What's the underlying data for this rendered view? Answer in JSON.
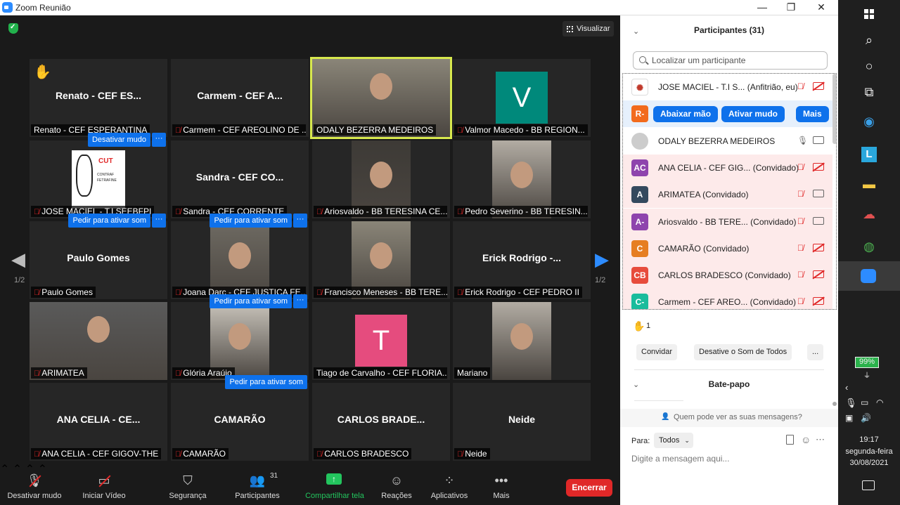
{
  "window": {
    "title": "Zoom Reunião",
    "minimize": "—",
    "maximize": "❐",
    "close": "✕"
  },
  "meeting": {
    "view_label": "Visualizar",
    "page_indicator_left": "1/2",
    "page_indicator_right": "1/2",
    "tiles": [
      {
        "label": "Renato - CEF ESPERANTINA",
        "center": "Renato - CEF ES...",
        "muted": false,
        "hand": true
      },
      {
        "label": "Carmem - CEF AREOLINO DE ...",
        "center": "Carmem - CEF A...",
        "muted": true
      },
      {
        "label": "ODALY BEZERRA MEDEIROS",
        "muted": false,
        "video": true,
        "active": true
      },
      {
        "label": "Valmor Macedo - BB REGION...",
        "avatar": "V",
        "avatar_color": "#00897b",
        "muted": true
      },
      {
        "label": "JOSE MACIEL - T.I SEEBFPI",
        "muted": true,
        "logo": true,
        "logo_text": "CUT",
        "logo_text2": "CONTRAF",
        "logo_text3": "FETRAFINE",
        "pill": "Desativar mudo",
        "pill_more": "···"
      },
      {
        "label": "Sandra - CEF CORRENTE",
        "center": "Sandra - CEF CO...",
        "muted": true
      },
      {
        "label": "Ariosvaldo - BB TERESINA CE...",
        "muted": true,
        "video": true
      },
      {
        "label": "Pedro Severino - BB TERESIN...",
        "muted": true,
        "video": true
      },
      {
        "label": "Paulo Gomes",
        "center": "Paulo Gomes",
        "muted": true,
        "pill": "Pedir para ativar som",
        "pill_more": "···"
      },
      {
        "label": "Joana Darc - CEF JUSTIÇA FE...",
        "muted": true,
        "video": true,
        "pill": "Pedir para ativar som",
        "pill_more": "···"
      },
      {
        "label": "Francisco Meneses - BB TERE...",
        "muted": true,
        "video": true
      },
      {
        "label": "Erick Rodrigo - CEF PEDRO II",
        "center": "Erick Rodrigo -...",
        "muted": true
      },
      {
        "label": "ARIMATEA",
        "muted": true,
        "video": true
      },
      {
        "label": "Glória Araújo",
        "muted": true,
        "video": true,
        "pill": "Pedir para ativar som",
        "pill_more": "···"
      },
      {
        "label": "Tiago de Carvalho - CEF FLORIA...",
        "avatar": "T",
        "avatar_color": "#e54c7e",
        "muted": false
      },
      {
        "label": "Mariano",
        "muted": false,
        "video": true
      },
      {
        "label": "ANA CELIA - CEF GIGOV-THE",
        "center": "ANA CELIA - CE...",
        "muted": true
      },
      {
        "label": "CAMARÃO",
        "center": "CAMARÃO",
        "muted": true,
        "pill": "Pedir para ativar som"
      },
      {
        "label": "CARLOS BRADESCO",
        "center": "CARLOS BRADE...",
        "muted": true
      },
      {
        "label": "Neide",
        "center": "Neide",
        "muted": true
      }
    ]
  },
  "toolbar": {
    "unmute": "Desativar mudo",
    "video": "Iniciar Vídeo",
    "security": "Segurança",
    "participants": "Participantes",
    "participants_count": "31",
    "share": "Compartilhar tela",
    "reactions": "Reações",
    "apps": "Aplicativos",
    "more": "Mais",
    "end": "Encerrar"
  },
  "panel": {
    "participants_header": "Participantes (31)",
    "search_placeholder": "Localizar um participante",
    "participants": [
      {
        "initials": "",
        "color": "#ffffff",
        "name": "JOSE MACIEL - T.I S... (Anfitrião, eu)",
        "mic": "off",
        "video": "off"
      },
      {
        "initials": "R-",
        "color": "#f26b1d",
        "name": "",
        "actions": [
          "Abaixar mão",
          "Ativar mudo",
          "Mais"
        ]
      },
      {
        "initials": "",
        "color": "#cccccc",
        "name": "ODALY BEZERRA MEDEIROS",
        "mic": "on",
        "video": "on"
      },
      {
        "initials": "AC",
        "color": "#8e44ad",
        "name": "ANA CELIA - CEF GIG... (Convidado)",
        "mic": "off",
        "video": "off"
      },
      {
        "initials": "A",
        "color": "#34495e",
        "name": "ARIMATEA (Convidado)",
        "mic": "off",
        "video": "on"
      },
      {
        "initials": "A-",
        "color": "#8e44ad",
        "name": "Ariosvaldo - BB TERE... (Convidado)",
        "mic": "off",
        "video": "on"
      },
      {
        "initials": "C",
        "color": "#e67e22",
        "name": "CAMARÃO (Convidado)",
        "mic": "off",
        "video": "off"
      },
      {
        "initials": "CB",
        "color": "#e74c3c",
        "name": "CARLOS BRADESCO (Convidado)",
        "mic": "off",
        "video": "off"
      },
      {
        "initials": "C-",
        "color": "#1abc9c",
        "name": "Carmem - CEF AREO... (Convidado)",
        "mic": "off",
        "video": "off"
      }
    ],
    "hand_count": "1",
    "invite": "Convidar",
    "mute_all": "Desative o Som de Todos",
    "more": "...",
    "chat_header": "Bate-papo",
    "chat_visibility": "Quem pode ver as suas mensagens?",
    "to_label": "Para:",
    "to_value": "Todos",
    "message_placeholder": "Digite a mensagem aqui..."
  },
  "taskbar": {
    "battery": "99%",
    "time": "19:17",
    "day": "segunda-feira",
    "date": "30/08/2021"
  }
}
